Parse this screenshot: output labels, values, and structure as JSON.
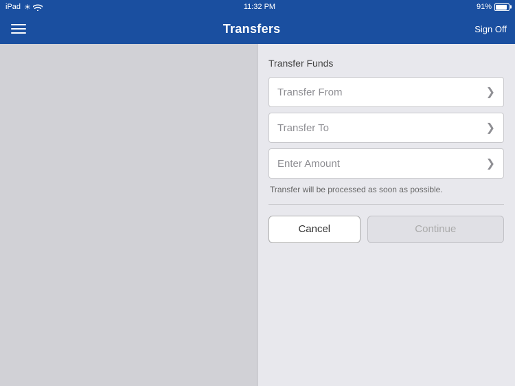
{
  "status_bar": {
    "device": "iPad",
    "wifi_signal": "▾",
    "time": "11:32 PM",
    "battery_percent": "91%"
  },
  "nav": {
    "menu_icon_label": "Menu",
    "title": "Transfers",
    "sign_off_label": "Sign Off"
  },
  "form": {
    "section_title": "Transfer Funds",
    "transfer_from_label": "Transfer From",
    "transfer_to_label": "Transfer To",
    "enter_amount_label": "Enter Amount",
    "info_text": "Transfer will be processed as soon as possible.",
    "cancel_label": "Cancel",
    "continue_label": "Continue"
  }
}
